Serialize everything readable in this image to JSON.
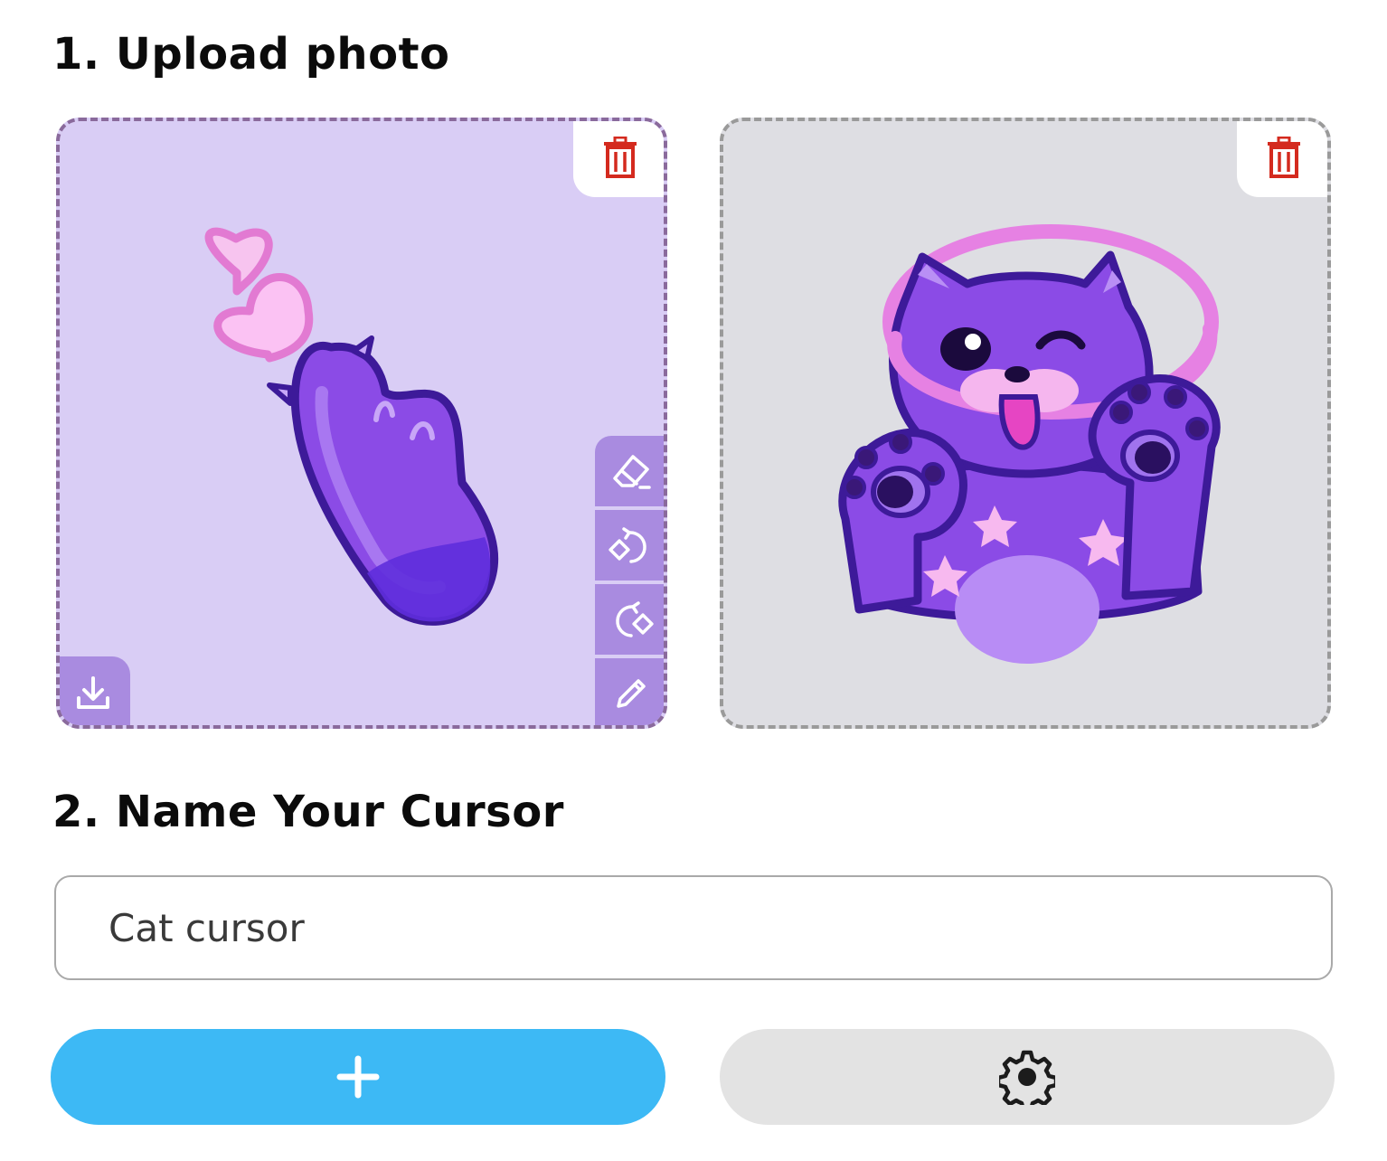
{
  "steps": {
    "upload": {
      "title": "1.  Upload photo"
    },
    "name": {
      "title": "2. Name Your Cursor"
    }
  },
  "name_input": {
    "value": "Cat cursor"
  },
  "images": [
    {
      "subject": "purple cat paw with pink hearts",
      "selected": true
    },
    {
      "subject": "purple cat with pink halo waving paws",
      "selected": false
    }
  ],
  "icons": {
    "delete": "trash-icon",
    "tools": [
      "eraser-icon",
      "rotate-left-icon",
      "rotate-right-icon",
      "pencil-icon"
    ],
    "download": "download-icon",
    "add": "plus-icon",
    "settings": "gear-icon"
  },
  "colors": {
    "selected_card_bg": "#d9cdf5",
    "selected_card_border": "#8a6a9c",
    "unselected_card_bg": "#dedee3",
    "unselected_card_border": "#9a9a9a",
    "tool_bg": "#a98be0",
    "delete_icon": "#d42a1e",
    "add_button": "#3db9f5",
    "settings_button": "#e3e3e3"
  }
}
